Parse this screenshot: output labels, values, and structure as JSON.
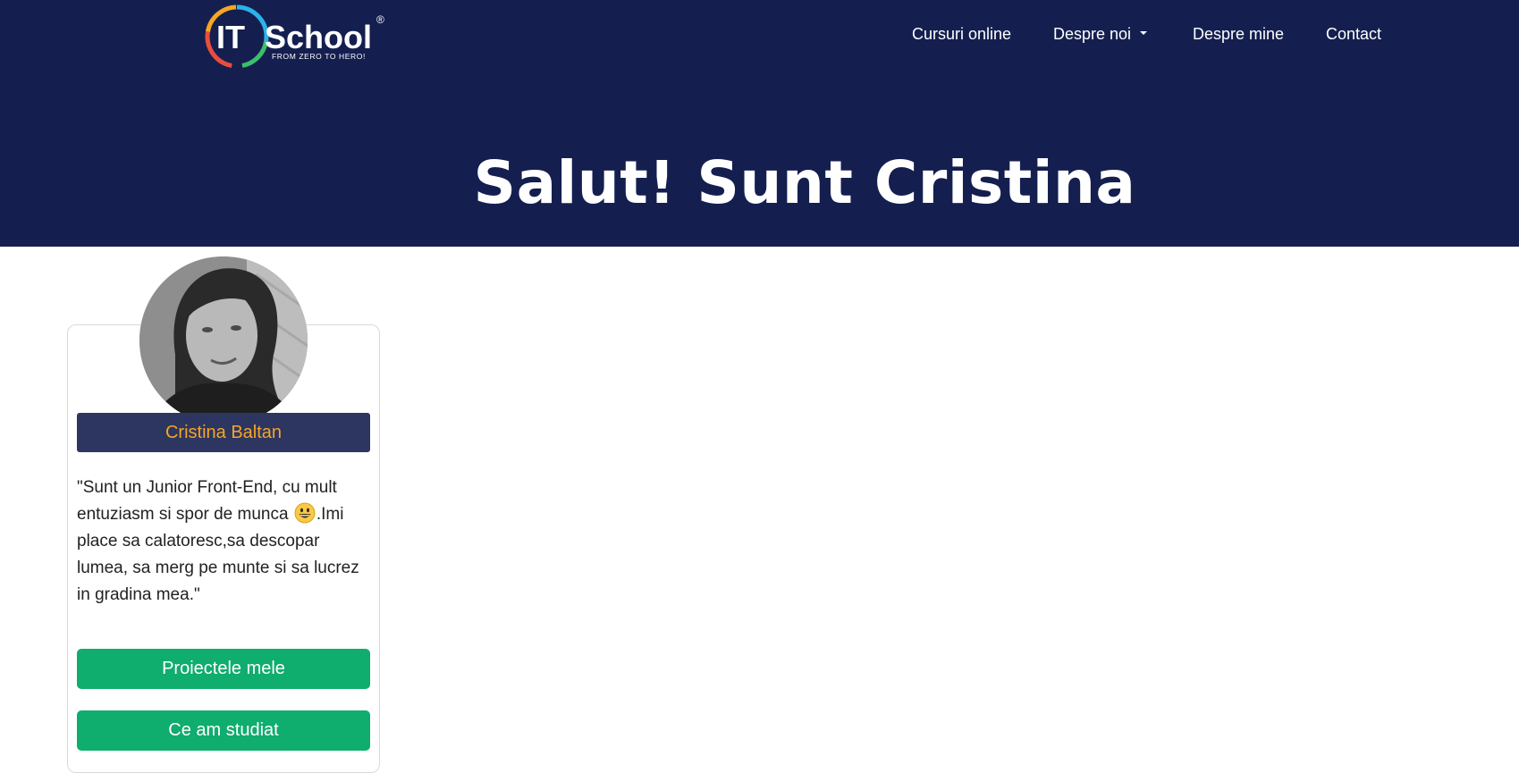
{
  "brand": {
    "logo_main": "IT",
    "logo_school": "School",
    "logo_tagline": "FROM ZERO TO HERO!",
    "logo_registered": "®"
  },
  "nav": {
    "items": [
      {
        "label": "Cursuri online"
      },
      {
        "label": "Despre noi",
        "has_dropdown": true
      },
      {
        "label": "Despre mine"
      },
      {
        "label": "Contact"
      }
    ]
  },
  "hero": {
    "title": "Salut! Sunt Cristina"
  },
  "profile": {
    "name": "Cristina Baltan",
    "bio_part1": "\"Sunt un Junior Front-End, cu mult entuziasm si spor de munca ",
    "bio_emoji": "grinning-face-emoji",
    "bio_part2": ".Imi place sa calatoresc,sa descopar lumea, sa merg pe munte si sa lucrez in gradina mea.\""
  },
  "buttons": {
    "projects": "Proiectele mele",
    "studies": "Ce am studiat"
  },
  "colors": {
    "header_bg": "#141f50",
    "name_bar_bg": "#2d3561",
    "name_text": "#f5a623",
    "button_bg": "#0fad6e"
  }
}
